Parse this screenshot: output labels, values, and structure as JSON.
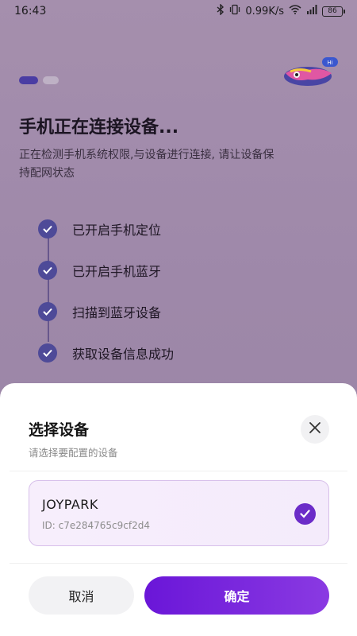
{
  "status_bar": {
    "time": "16:43",
    "network_speed": "0.99K/s",
    "battery": "86",
    "icons": [
      "bluetooth-icon",
      "vibrate-icon",
      "wifi-icon",
      "signal-icon",
      "battery-icon"
    ]
  },
  "background": {
    "title": "手机正在连接设备...",
    "description": "正在检测手机系统权限,与设备进行连接, 请让设备保持配网状态",
    "logo_badge": "Hi",
    "steps": [
      {
        "label": "已开启手机定位"
      },
      {
        "label": "已开启手机蓝牙"
      },
      {
        "label": "扫描到蓝牙设备"
      },
      {
        "label": "获取设备信息成功"
      }
    ]
  },
  "sheet": {
    "title": "选择设备",
    "subtitle": "请选择要配置的设备",
    "device": {
      "name": "JOYPARK",
      "id": "ID: c7e284765c9cf2d4"
    },
    "cancel_label": "取消",
    "confirm_label": "确定"
  },
  "colors": {
    "accent": "#6b2cc8",
    "step_check": "#4e4a98",
    "confirm_gradient_start": "#6a16d8",
    "confirm_gradient_end": "#8a3ae2"
  }
}
